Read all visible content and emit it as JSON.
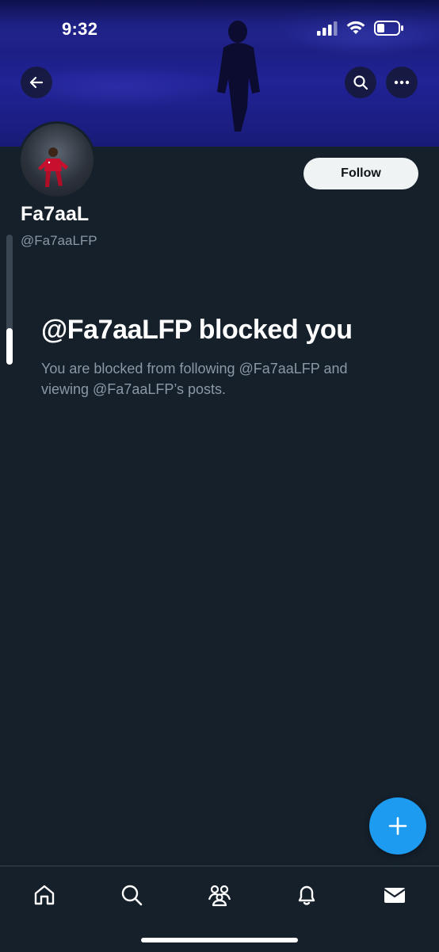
{
  "status_bar": {
    "time": "9:32",
    "icons": [
      "signal-icon",
      "wifi-icon",
      "battery-icon"
    ]
  },
  "header": {
    "buttons": [
      "back-arrow-icon",
      "search-icon",
      "more-icon"
    ]
  },
  "profile": {
    "display_name": "Fa7aaL",
    "handle": "@Fa7aaLFP",
    "follow_label": "Follow"
  },
  "blocked": {
    "title": "@Fa7aaLFP blocked you",
    "description": "You are blocked from following @Fa7aaLFP and viewing @Fa7aaLFP’s posts."
  },
  "fab": {
    "icon": "plus-icon"
  },
  "tab_bar": {
    "items": [
      "home-icon",
      "search-icon",
      "communities-icon",
      "notifications-icon",
      "messages-icon"
    ]
  },
  "colors": {
    "background": "#15202b",
    "accent": "#1d9bf0",
    "secondary_text": "#8b98a5",
    "follow_button_bg": "#eff3f4"
  }
}
